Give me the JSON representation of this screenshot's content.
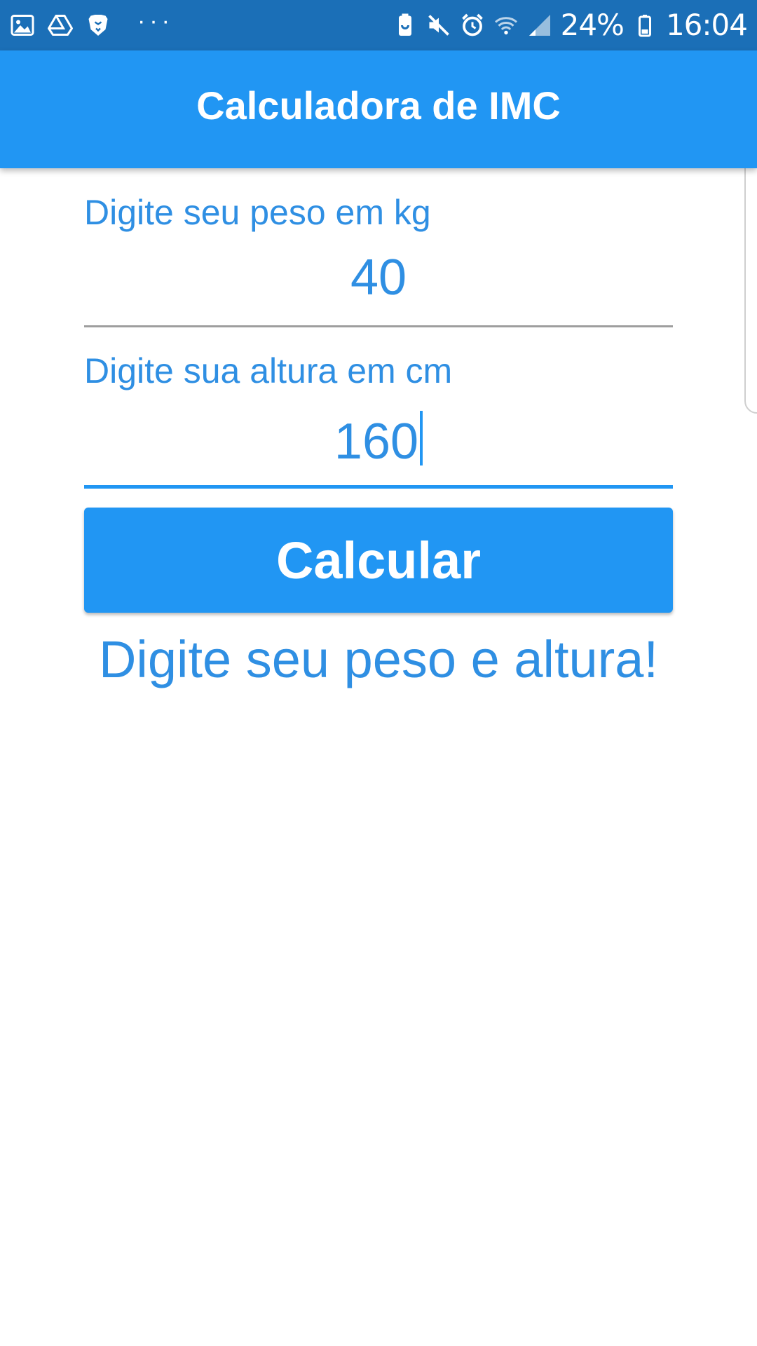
{
  "status_bar": {
    "battery": "24%",
    "time": "16:04",
    "left_icons": [
      "image-icon",
      "drive-icon",
      "brave-lion-icon",
      "more-dots-icon"
    ],
    "more": "···",
    "right_icons": [
      "battery-saver-icon",
      "mute-icon",
      "alarm-icon",
      "wifi-icon",
      "signal-icon",
      "battery-icon"
    ]
  },
  "app_bar": {
    "title": "Calculadora de IMC"
  },
  "form": {
    "weight": {
      "label": "Digite seu peso em kg",
      "value": "40"
    },
    "height": {
      "label": "Digite sua altura em cm",
      "value": "160"
    },
    "button_label": "Calcular"
  },
  "result": {
    "message": "Digite seu peso e altura!"
  },
  "colors": {
    "status_bar": "#1b6fb7",
    "primary": "#2196f3",
    "text_accent": "#2f8fe3",
    "underline_inactive": "#9e9e9e"
  }
}
